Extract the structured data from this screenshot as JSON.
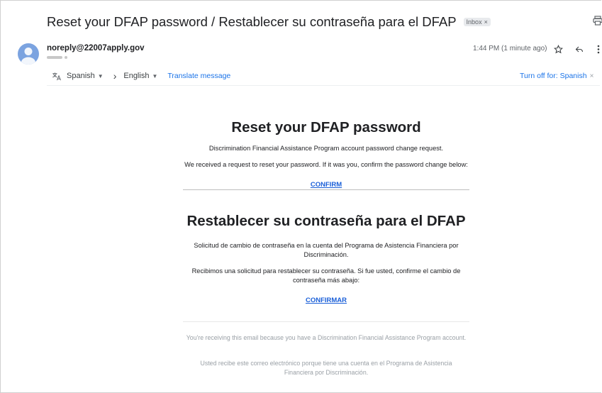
{
  "email": {
    "subject": "Reset your DFAP password / Restablecer su contraseña para el DFAP",
    "label": "Inbox",
    "label_close": "×",
    "sender": "noreply@22007apply.gov",
    "time": "1:44 PM (1 minute ago)"
  },
  "translate": {
    "from_lang": "Spanish",
    "arrow": "›",
    "to_lang": "English",
    "translate_link": "Translate message",
    "turn_off": "Turn off for: Spanish",
    "turn_off_close": "×"
  },
  "body": {
    "en_title": "Reset your DFAP password",
    "en_line1": "Discrimination Financial Assistance Program account password change request.",
    "en_line2": "We received a request to reset your password. If it was you, confirm the password change below:",
    "en_confirm": "CONFIRM",
    "es_title": "Restablecer su contraseña para el DFAP",
    "es_line1": "Solicitud de cambio de contraseña en la cuenta del Programa de Asistencia Financiera por Discriminación.",
    "es_line2": "Recibimos una solicitud para restablecer su contraseña. Si fue usted, confirme el cambio de contraseña más abajo:",
    "es_confirm": "CONFIRMAR",
    "footer_en": "You're receiving this email because you have a Discrimination Financial Assistance Program account.",
    "footer_es": "Usted recibe este correo electrónico porque tiene una cuenta en el Programa de Asistencia Financiera por Discriminación."
  },
  "icons": {
    "print": "print-icon",
    "star": "star-icon",
    "reply": "reply-icon",
    "more": "more-vert-icon",
    "translate": "translate-icon",
    "avatar": "avatar-person-icon"
  }
}
